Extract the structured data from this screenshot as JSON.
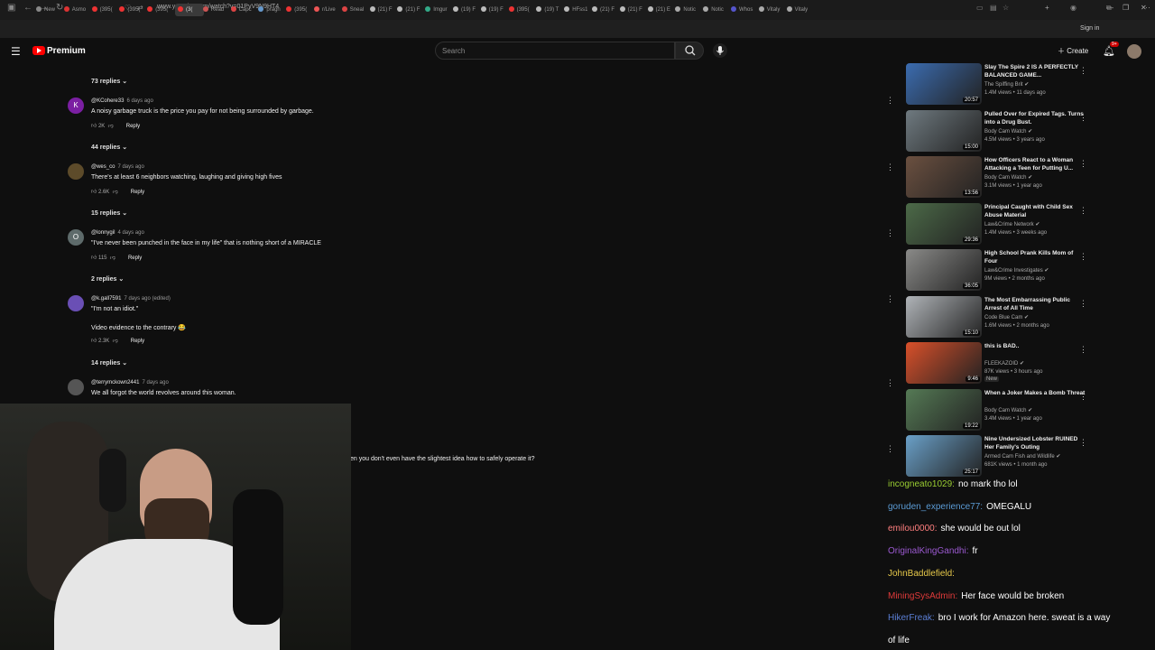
{
  "browser": {
    "tabs": [
      "New",
      "Asmo",
      "(395(",
      "(395(",
      "(395(",
      "(3(",
      "Read",
      "Capc",
      "pragn",
      "(395(",
      "r/Live",
      "Sneal",
      "(21) F",
      "(21) F",
      "Imgur",
      "(19) F",
      "(19) F",
      "(395(",
      "(19) T",
      "HFss1",
      "(21) F",
      "(21) F",
      "(21) E",
      "Notic",
      "Notic",
      "Whos",
      "Vitaly",
      "Vitaly"
    ],
    "url": "www.youtube.com/watch?v=01PyV9N9HT4",
    "signin": "Sign in"
  },
  "youtube": {
    "logo_text": "Premium",
    "search_placeholder": "Search",
    "create_label": "Create",
    "notif_count": "9+"
  },
  "comments": [
    {
      "replies": "73 replies"
    },
    {
      "avatar": "K",
      "avatar_color": "#7b1fa2",
      "user": "@KCohere33",
      "time": "6 days ago",
      "text": "A noisy garbage truck is the price you pay for not being surrounded by garbage.",
      "likes": "2K",
      "reply": "Reply",
      "replies": "44 replies"
    },
    {
      "avatar": "",
      "avatar_color": "#5d4b2a",
      "user": "@wes_co",
      "time": "7 days ago",
      "text": "There's at least 6 neighbors watching, laughing and giving high fives",
      "likes": "2.6K",
      "reply": "Reply",
      "replies": "15 replies"
    },
    {
      "avatar": "O",
      "avatar_color": "#5e6b6b",
      "user": "@lonnygil",
      "time": "4 days ago",
      "text": "\"I've never been punched in the face in my life\" that is nothing short of a MIRACLE",
      "likes": "115",
      "reply": "Reply",
      "replies": "2 replies"
    },
    {
      "avatar": "",
      "avatar_color": "#6a4fb5",
      "user": "@k.gall7591",
      "time": "7 days ago (edited)",
      "text": "\"I'm not an idiot.\"",
      "text2": "Video evidence to the contrary 😂",
      "likes": "2.3K",
      "reply": "Reply",
      "replies": "14 replies"
    },
    {
      "avatar": "",
      "avatar_color": "#555",
      "user": "@terrymckown2441",
      "time": "7 days ago",
      "text": "We all forgot the world revolves around this woman."
    }
  ],
  "partial_comment": "en you don't even have the slightest idea how to safely operate it?",
  "sidebar": [
    {
      "title": "Slay The Spire 2 IS A PERFECTLY BALANCED GAME...",
      "channel": "The Spiffing Brit",
      "meta": "1.4M views • 11 days ago",
      "duration": "20:57",
      "color": "#3b6cb0"
    },
    {
      "title": "Pulled Over for Expired Tags. Turns into a Drug Bust.",
      "channel": "Body Cam Watch",
      "meta": "4.5M views • 3 years ago",
      "duration": "15:00",
      "color": "#6f7a80"
    },
    {
      "title": "How Officers React to a Woman Attacking a Teen for Putting U...",
      "channel": "Body Cam Watch",
      "meta": "3.1M views • 1 year ago",
      "duration": "13:56",
      "color": "#6b5040"
    },
    {
      "title": "Principal Caught with Child Sex Abuse Material",
      "channel": "Law&Crime Network",
      "meta": "1.4M views • 3 weeks ago",
      "duration": "29:36",
      "color": "#4c6a48"
    },
    {
      "title": "High School Prank Kills Mom of Four",
      "channel": "Law&Crime Investigates",
      "meta": "9M views • 2 months ago",
      "duration": "36:05",
      "color": "#8a8a88"
    },
    {
      "title": "The Most Embarrassing Public Arrest of All Time",
      "channel": "Code Blue Cam",
      "meta": "1.6M views • 2 months ago",
      "duration": "15:10",
      "color": "#b0b4b8"
    },
    {
      "title": "this is BAD..",
      "channel": "FLEEKAZOID",
      "meta": "87K views • 3 hours ago",
      "badge": "New",
      "duration": "9:46",
      "color": "#d9502a"
    },
    {
      "title": "When a Joker Makes a Bomb Threat",
      "channel": "Body Cam Watch",
      "meta": "3.4M views • 1 year ago",
      "duration": "19:22",
      "color": "#557a55"
    },
    {
      "title": "Nine Undersized Lobster RUINED Her Family's Outing",
      "channel": "Armed Cam Fish and Wildlife",
      "meta": "681K views • 1 month ago",
      "duration": "25:17",
      "color": "#6aa0c8"
    }
  ],
  "chat": [
    {
      "user": "incogneato1029:",
      "color": "#9acd32",
      "msg": "no mark tho lol"
    },
    {
      "user": "goruden_experience77:",
      "color": "#5b9bd5",
      "msg": "OMEGALU"
    },
    {
      "user": "emilou0000:",
      "color": "#ff7f7f",
      "msg": "she would be out lol"
    },
    {
      "user": "OriginalKingGandhi:",
      "color": "#9b59d0",
      "msg": "fr"
    },
    {
      "user": "JohnBaddlefield:",
      "color": "#e6c84a",
      "msg": ""
    },
    {
      "user": "MiningSysAdmin:",
      "color": "#e03a3a",
      "msg": "Her face would be broken"
    },
    {
      "user": "HikerFreak:",
      "color": "#5b7fd5",
      "msg": "bro I work for Amazon here. sweat is a way"
    },
    {
      "user": "",
      "color": "#fff",
      "msg": "of life"
    }
  ]
}
